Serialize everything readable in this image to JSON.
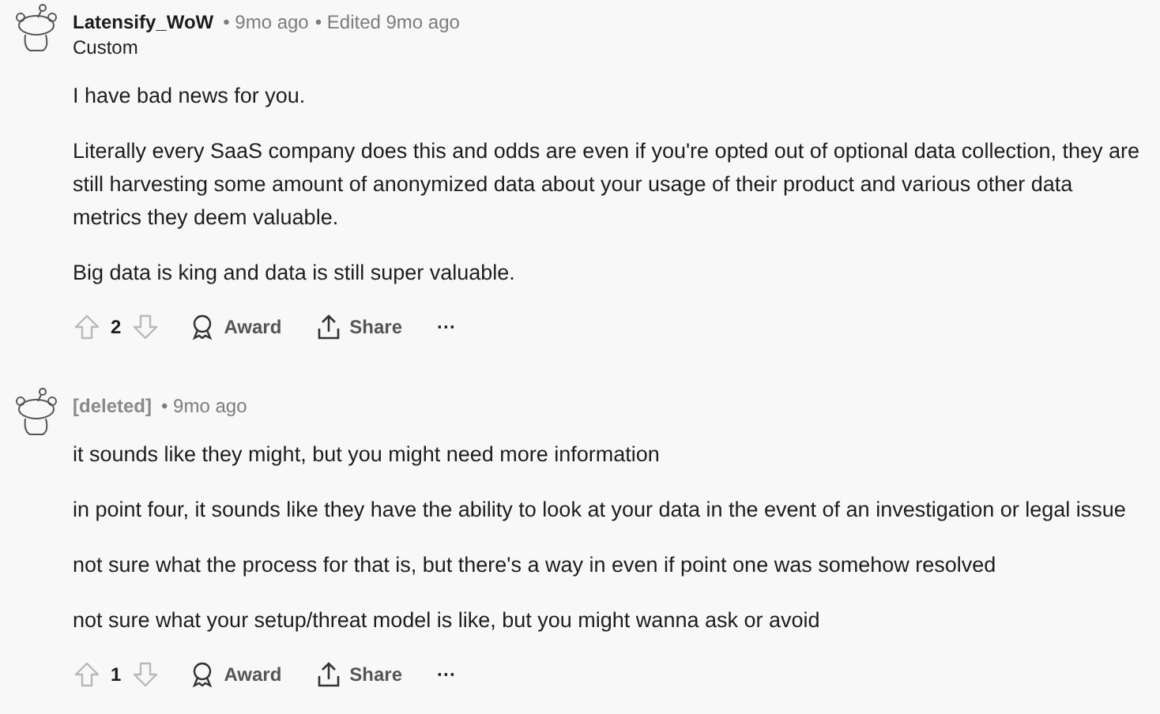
{
  "comments": [
    {
      "author": {
        "name": "Latensify_WoW",
        "deleted": false
      },
      "time": "• 9mo ago",
      "edited": "• Edited 9mo ago",
      "flair": "Custom",
      "paragraphs": [
        "I have bad news for you.",
        "Literally every SaaS company does this and odds are even if you're opted out of optional data collection, they are still harvesting some amount of anonymized data about your usage of their product and various other data metrics they deem valuable.",
        "Big data is king and data is still super valuable."
      ],
      "score": "2",
      "award": "Award",
      "share": "Share",
      "more": "···"
    },
    {
      "author": {
        "name": "[deleted]",
        "deleted": true
      },
      "time": "• 9mo ago",
      "paragraphs": [
        "it sounds like they might, but you might need more information",
        "in point four, it sounds like they have the ability to look at your data in the event of an investigation or legal issue",
        "not sure what the process for that is, but there's a way in even if point one was somehow resolved",
        "not sure what your setup/threat model is like, but you might wanna ask or avoid"
      ],
      "score": "1",
      "award": "Award",
      "share": "Share",
      "more": "···"
    }
  ]
}
